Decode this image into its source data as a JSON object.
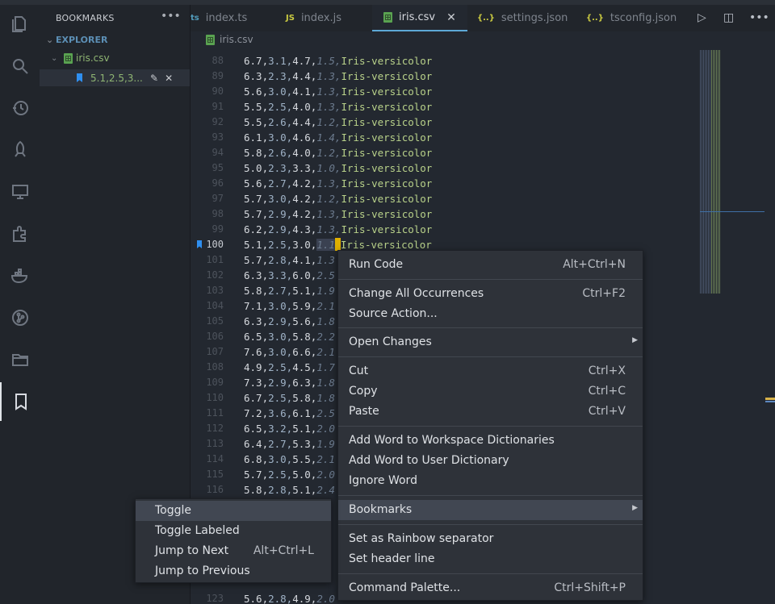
{
  "sidebar": {
    "title": "BOOKMARKS",
    "more": "•••",
    "explorer_label": "EXPLORER",
    "file": "iris.csv",
    "bookmark_label": "5.1,2.5,3....",
    "edit_icon": "✎",
    "close_icon": "✕"
  },
  "tabs": [
    {
      "icon": "ts",
      "label": "index.ts",
      "color": "#519aba"
    },
    {
      "icon": "JS",
      "label": "index.js",
      "color": "#cbcb41"
    },
    {
      "icon": "csv",
      "label": "iris.csv",
      "color": "#5aa351"
    },
    {
      "icon": "{..}",
      "label": "settings.json",
      "color": "#cbcb41"
    },
    {
      "icon": "{..}",
      "label": "tsconfig.json",
      "color": "#cbcb41"
    }
  ],
  "tab_close": "✕",
  "toolbar": {
    "run": "▷",
    "split": "◫",
    "more": "•••"
  },
  "breadcrumb": {
    "file": "iris.csv"
  },
  "editor": {
    "current_line": "100",
    "lines": [
      {
        "n": "88",
        "a": "6.7,",
        "b": "3.1,",
        "c": "4.7,",
        "d": "1.5,",
        "e": "Iris-versicolor"
      },
      {
        "n": "89",
        "a": "6.3,",
        "b": "2.3,",
        "c": "4.4,",
        "d": "1.3,",
        "e": "Iris-versicolor"
      },
      {
        "n": "90",
        "a": "5.6,",
        "b": "3.0,",
        "c": "4.1,",
        "d": "1.3,",
        "e": "Iris-versicolor"
      },
      {
        "n": "91",
        "a": "5.5,",
        "b": "2.5,",
        "c": "4.0,",
        "d": "1.3,",
        "e": "Iris-versicolor"
      },
      {
        "n": "92",
        "a": "5.5,",
        "b": "2.6,",
        "c": "4.4,",
        "d": "1.2,",
        "e": "Iris-versicolor"
      },
      {
        "n": "93",
        "a": "6.1,",
        "b": "3.0,",
        "c": "4.6,",
        "d": "1.4,",
        "e": "Iris-versicolor"
      },
      {
        "n": "94",
        "a": "5.8,",
        "b": "2.6,",
        "c": "4.0,",
        "d": "1.2,",
        "e": "Iris-versicolor"
      },
      {
        "n": "95",
        "a": "5.0,",
        "b": "2.3,",
        "c": "3.3,",
        "d": "1.0,",
        "e": "Iris-versicolor"
      },
      {
        "n": "96",
        "a": "5.6,",
        "b": "2.7,",
        "c": "4.2,",
        "d": "1.3,",
        "e": "Iris-versicolor"
      },
      {
        "n": "97",
        "a": "5.7,",
        "b": "3.0,",
        "c": "4.2,",
        "d": "1.2,",
        "e": "Iris-versicolor"
      },
      {
        "n": "98",
        "a": "5.7,",
        "b": "2.9,",
        "c": "4.2,",
        "d": "1.3,",
        "e": "Iris-versicolor"
      },
      {
        "n": "99",
        "a": "6.2,",
        "b": "2.9,",
        "c": "4.3,",
        "d": "1.3,",
        "e": "Iris-versicolor"
      },
      {
        "n": "100",
        "a": "5.1,",
        "b": "2.5,",
        "c": "3.0,",
        "d": "1.1",
        "e": "Iris-versicolor"
      },
      {
        "n": "101",
        "a": "5.7,",
        "b": "2.8,",
        "c": "4.1,",
        "d": "1.3",
        "e": ""
      },
      {
        "n": "102",
        "a": "6.3,",
        "b": "3.3,",
        "c": "6.0,",
        "d": "2.5",
        "e": ""
      },
      {
        "n": "103",
        "a": "5.8,",
        "b": "2.7,",
        "c": "5.1,",
        "d": "1.9",
        "e": ""
      },
      {
        "n": "104",
        "a": "7.1,",
        "b": "3.0,",
        "c": "5.9,",
        "d": "2.1",
        "e": ""
      },
      {
        "n": "105",
        "a": "6.3,",
        "b": "2.9,",
        "c": "5.6,",
        "d": "1.8",
        "e": ""
      },
      {
        "n": "106",
        "a": "6.5,",
        "b": "3.0,",
        "c": "5.8,",
        "d": "2.2",
        "e": ""
      },
      {
        "n": "107",
        "a": "7.6,",
        "b": "3.0,",
        "c": "6.6,",
        "d": "2.1",
        "e": ""
      },
      {
        "n": "108",
        "a": "4.9,",
        "b": "2.5,",
        "c": "4.5,",
        "d": "1.7",
        "e": ""
      },
      {
        "n": "109",
        "a": "7.3,",
        "b": "2.9,",
        "c": "6.3,",
        "d": "1.8",
        "e": ""
      },
      {
        "n": "110",
        "a": "6.7,",
        "b": "2.5,",
        "c": "5.8,",
        "d": "1.8",
        "e": ""
      },
      {
        "n": "111",
        "a": "7.2,",
        "b": "3.6,",
        "c": "6.1,",
        "d": "2.5",
        "e": ""
      },
      {
        "n": "112",
        "a": "6.5,",
        "b": "3.2,",
        "c": "5.1,",
        "d": "2.0",
        "e": ""
      },
      {
        "n": "113",
        "a": "6.4,",
        "b": "2.7,",
        "c": "5.3,",
        "d": "1.9",
        "e": ""
      },
      {
        "n": "114",
        "a": "6.8,",
        "b": "3.0,",
        "c": "5.5,",
        "d": "2.1",
        "e": ""
      },
      {
        "n": "115",
        "a": "5.7,",
        "b": "2.5,",
        "c": "5.0,",
        "d": "2.0",
        "e": ""
      },
      {
        "n": "116",
        "a": "5.8,",
        "b": "2.8,",
        "c": "5.1,",
        "d": "2.4",
        "e": ""
      },
      {
        "n": "123",
        "a": "5.6,",
        "b": "2.8,",
        "c": "4.9,",
        "d": "2.0",
        "e": ""
      }
    ]
  },
  "context_menu": [
    {
      "label": "Run Code",
      "key": "Alt+Ctrl+N"
    },
    {
      "sep": true
    },
    {
      "label": "Change All Occurrences",
      "key": "Ctrl+F2"
    },
    {
      "label": "Source Action...",
      "key": ""
    },
    {
      "sep": true
    },
    {
      "label": "Open Changes",
      "key": "",
      "submenu": true
    },
    {
      "sep": true
    },
    {
      "label": "Cut",
      "key": "Ctrl+X"
    },
    {
      "label": "Copy",
      "key": "Ctrl+C"
    },
    {
      "label": "Paste",
      "key": "Ctrl+V"
    },
    {
      "sep": true
    },
    {
      "label": "Add Word to Workspace Dictionaries",
      "key": ""
    },
    {
      "label": "Add Word to User Dictionary",
      "key": ""
    },
    {
      "label": "Ignore Word",
      "key": ""
    },
    {
      "sep": true
    },
    {
      "label": "Bookmarks",
      "key": "",
      "submenu": true,
      "selected": true
    },
    {
      "sep": true
    },
    {
      "label": "Set as Rainbow separator",
      "key": ""
    },
    {
      "label": "Set header line",
      "key": ""
    },
    {
      "sep": true
    },
    {
      "label": "Command Palette...",
      "key": "Ctrl+Shift+P"
    }
  ],
  "bookmarks_submenu": [
    {
      "label": "Toggle",
      "key": "",
      "selected": true
    },
    {
      "label": "Toggle Labeled",
      "key": ""
    },
    {
      "label": "Jump to Next",
      "key": "Alt+Ctrl+L"
    },
    {
      "label": "Jump to Previous",
      "key": ""
    }
  ]
}
